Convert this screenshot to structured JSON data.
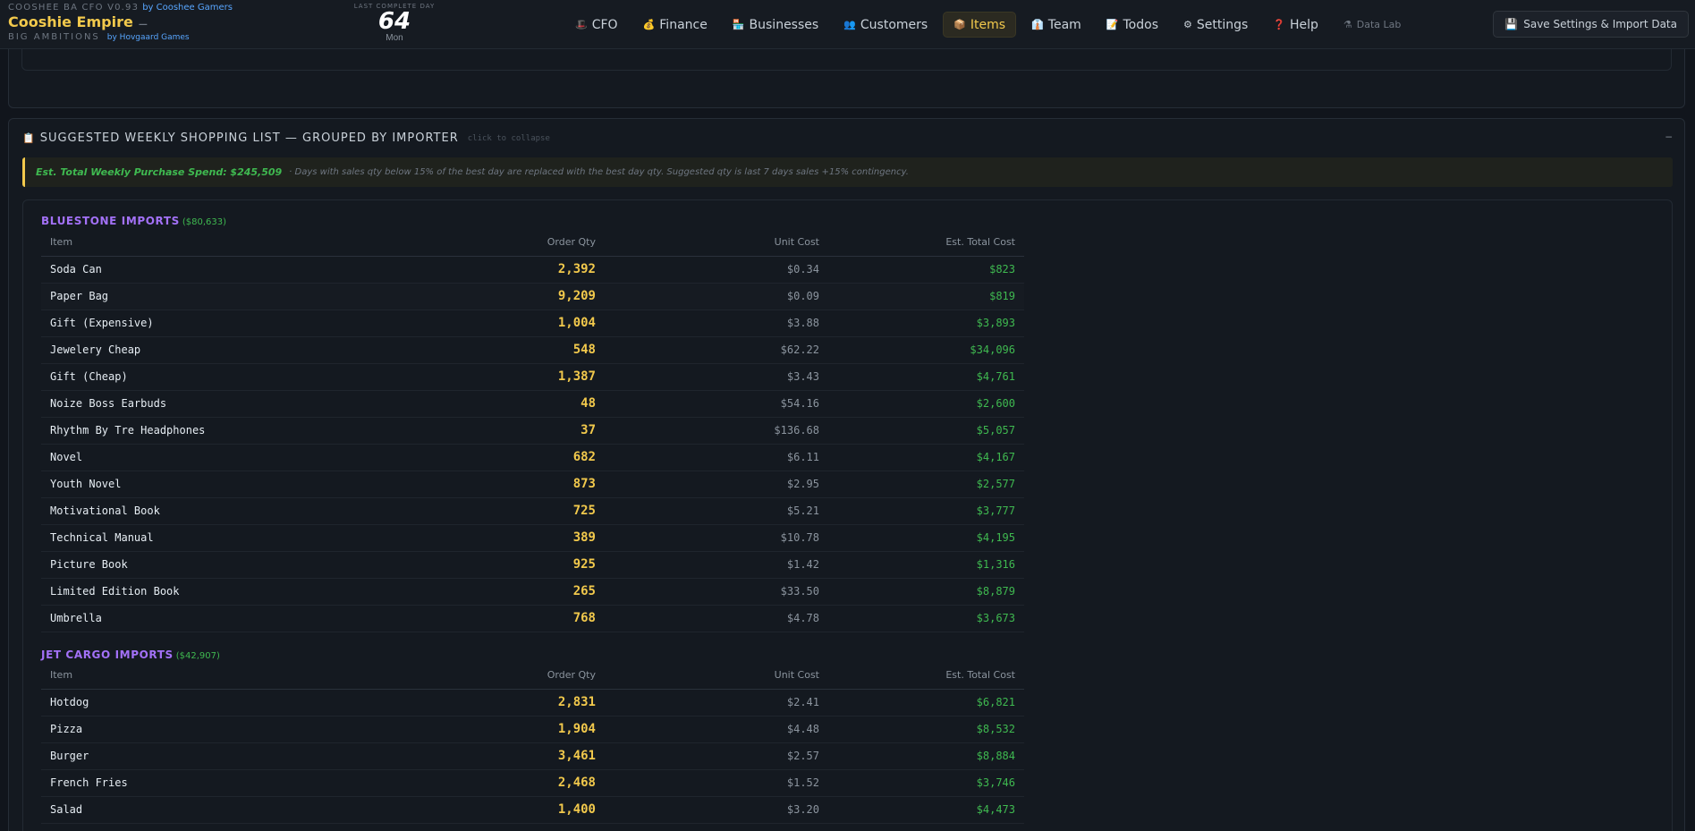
{
  "app": {
    "version_line": "COOSHEE BA CFO V0.93",
    "by_top": "by Cooshee Gamers",
    "title": "Cooshie Empire",
    "title_suffix": "—",
    "tagline": "BIG AMBITIONS",
    "by_bottom": "by Hovgaard Games"
  },
  "day": {
    "label": "LAST COMPLETE DAY",
    "number": "64",
    "weekday": "Mon"
  },
  "nav": [
    {
      "icon": "🎩",
      "label": "CFO"
    },
    {
      "icon": "💰",
      "label": "Finance"
    },
    {
      "icon": "🏪",
      "label": "Businesses"
    },
    {
      "icon": "👥",
      "label": "Customers"
    },
    {
      "icon": "📦",
      "label": "Items"
    },
    {
      "icon": "👔",
      "label": "Team"
    },
    {
      "icon": "📝",
      "label": "Todos"
    },
    {
      "icon": "⚙",
      "label": "Settings"
    },
    {
      "icon": "❓",
      "label": "Help"
    },
    {
      "icon": "⚗",
      "label": "Data Lab"
    }
  ],
  "save_button": {
    "icon": "💾",
    "label": "Save Settings & Import Data"
  },
  "panel": {
    "icon": "📋",
    "title": "SUGGESTED WEEKLY SHOPPING LIST — GROUPED BY IMPORTER",
    "hint": "click to collapse",
    "collapse": "–"
  },
  "summary": {
    "main": "Est. Total Weekly Purchase Spend: $245,509",
    "note": "· Days with sales qty below 15% of the best day are replaced with the best day qty. Suggested qty is last 7 days sales +15% contingency."
  },
  "columns": {
    "item": "Item",
    "qty": "Order Qty",
    "unit": "Unit Cost",
    "total": "Est. Total Cost"
  },
  "groups": [
    {
      "name": "BLUESTONE IMPORTS",
      "total": "($80,633)",
      "rows": [
        {
          "item": "Soda Can",
          "qty": "2,392",
          "unit": "$0.34",
          "total": "$823"
        },
        {
          "item": "Paper Bag",
          "qty": "9,209",
          "unit": "$0.09",
          "total": "$819"
        },
        {
          "item": "Gift (Expensive)",
          "qty": "1,004",
          "unit": "$3.88",
          "total": "$3,893"
        },
        {
          "item": "Jewelery Cheap",
          "qty": "548",
          "unit": "$62.22",
          "total": "$34,096"
        },
        {
          "item": "Gift (Cheap)",
          "qty": "1,387",
          "unit": "$3.43",
          "total": "$4,761"
        },
        {
          "item": "Noize Boss Earbuds",
          "qty": "48",
          "unit": "$54.16",
          "total": "$2,600"
        },
        {
          "item": "Rhythm By Tre Headphones",
          "qty": "37",
          "unit": "$136.68",
          "total": "$5,057"
        },
        {
          "item": "Novel",
          "qty": "682",
          "unit": "$6.11",
          "total": "$4,167"
        },
        {
          "item": "Youth Novel",
          "qty": "873",
          "unit": "$2.95",
          "total": "$2,577"
        },
        {
          "item": "Motivational Book",
          "qty": "725",
          "unit": "$5.21",
          "total": "$3,777"
        },
        {
          "item": "Technical Manual",
          "qty": "389",
          "unit": "$10.78",
          "total": "$4,195"
        },
        {
          "item": "Picture Book",
          "qty": "925",
          "unit": "$1.42",
          "total": "$1,316"
        },
        {
          "item": "Limited Edition Book",
          "qty": "265",
          "unit": "$33.50",
          "total": "$8,879"
        },
        {
          "item": "Umbrella",
          "qty": "768",
          "unit": "$4.78",
          "total": "$3,673"
        }
      ]
    },
    {
      "name": "JET CARGO IMPORTS",
      "total": "($42,907)",
      "rows": [
        {
          "item": "Hotdog",
          "qty": "2,831",
          "unit": "$2.41",
          "total": "$6,821"
        },
        {
          "item": "Pizza",
          "qty": "1,904",
          "unit": "$4.48",
          "total": "$8,532"
        },
        {
          "item": "Burger",
          "qty": "3,461",
          "unit": "$2.57",
          "total": "$8,884"
        },
        {
          "item": "French Fries",
          "qty": "2,468",
          "unit": "$1.52",
          "total": "$3,746"
        },
        {
          "item": "Salad",
          "qty": "1,400",
          "unit": "$3.20",
          "total": "$4,473"
        }
      ]
    }
  ]
}
